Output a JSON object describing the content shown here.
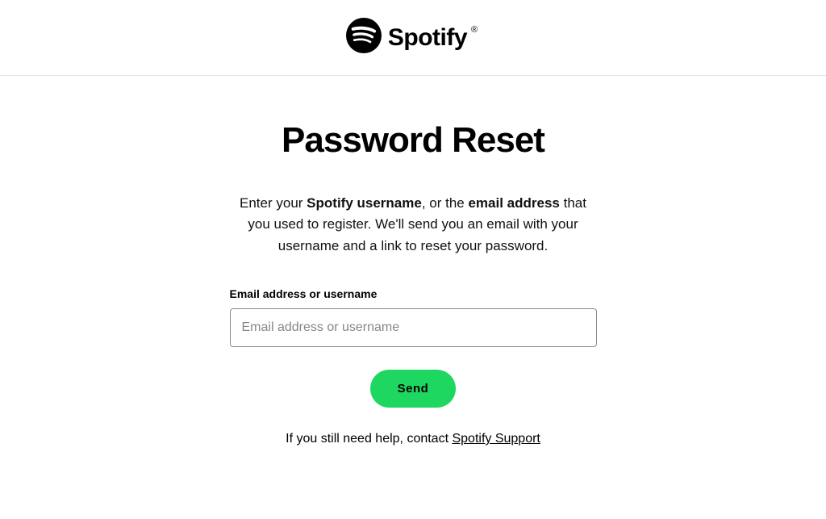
{
  "brand": {
    "name": "Spotify",
    "registered": "®"
  },
  "page": {
    "title": "Password Reset",
    "desc_1": "Enter your ",
    "desc_b1": "Spotify username",
    "desc_2": ", or the ",
    "desc_b2": "email address",
    "desc_3": " that you used to register. We'll send you an email with your username and a link to reset your password."
  },
  "form": {
    "label": "Email address or username",
    "placeholder": "Email address or username",
    "value": "",
    "send": "Send"
  },
  "help": {
    "prefix": "If you still need help, contact ",
    "link": "Spotify Support"
  }
}
